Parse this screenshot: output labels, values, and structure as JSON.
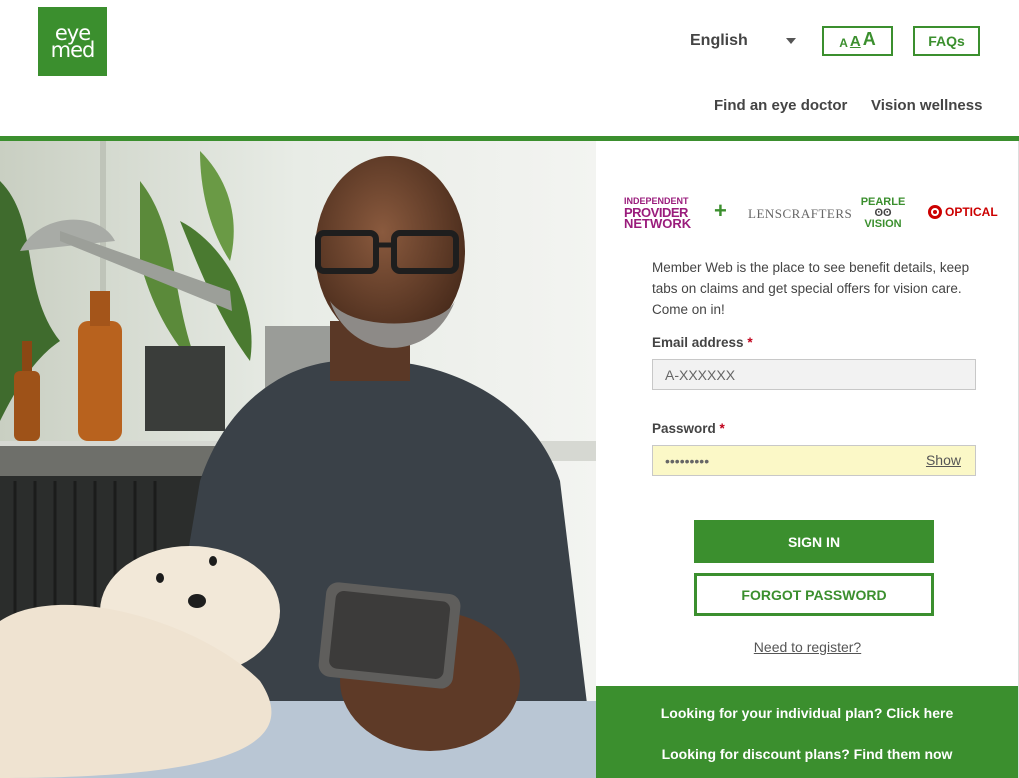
{
  "header": {
    "logo": [
      "eye",
      "med"
    ],
    "language": "English",
    "text_size": [
      "A",
      "A",
      "A"
    ],
    "faqs": "FAQs",
    "nav": {
      "find_doctor": "Find an eye doctor",
      "wellness": "Vision wellness"
    }
  },
  "partners": {
    "ipn": [
      "INDEPENDENT",
      "PROVIDER",
      "NETWORK"
    ],
    "plus": "+",
    "lenscrafters": "LENSCRAFTERS",
    "pearle": [
      "PEARLE",
      "VISION"
    ],
    "target": "OPTICAL"
  },
  "login": {
    "intro": "Member Web is the place to see benefit details, keep tabs on claims and get special offers for vision care.  Come on in!",
    "email_label": "Email address",
    "email_value": "A-XXXXXX",
    "password_label": "Password",
    "password_value": "•••••••••",
    "required_mark": "*",
    "show": "Show",
    "sign_in": "SIGN IN",
    "forgot": "FORGOT PASSWORD",
    "register": "Need to register?"
  },
  "promo": {
    "individual": "Looking for your individual plan? Click here",
    "discount": "Looking for discount plans? Find them now"
  },
  "colors": {
    "brand_green": "#3b8f2e",
    "required": "#c0001a",
    "autofill": "#fbf8c7"
  }
}
